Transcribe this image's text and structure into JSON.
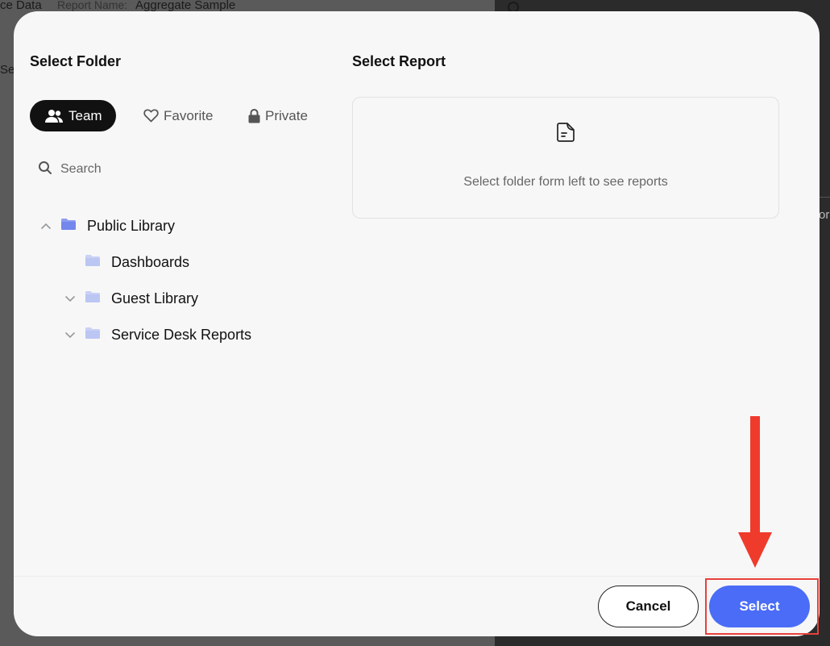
{
  "backdrop": {
    "data_label": "ce Data",
    "report_name_label": "Report Name:",
    "report_name_value": "Aggregate Sample",
    "side_text": "Se",
    "right_text": "or"
  },
  "modal": {
    "folder_title": "Select Folder",
    "report_title": "Select Report",
    "tabs": [
      {
        "label": "Team",
        "icon": "users-icon",
        "active": true
      },
      {
        "label": "Favorite",
        "icon": "heart-icon",
        "active": false
      },
      {
        "label": "Private",
        "icon": "lock-icon",
        "active": false
      }
    ],
    "search": {
      "placeholder": "Search"
    },
    "tree": [
      {
        "label": "Public Library",
        "expanded": true,
        "level": 0
      },
      {
        "label": "Dashboards",
        "expanded": false,
        "level": 1
      },
      {
        "label": "Guest Library",
        "expanded": false,
        "level": 1
      },
      {
        "label": "Service Desk Reports",
        "expanded": false,
        "level": 1
      }
    ],
    "report_empty_text": "Select folder form left to see reports",
    "buttons": {
      "cancel": "Cancel",
      "select": "Select"
    }
  },
  "colors": {
    "accent": "#4a6cf7",
    "folder_primary": "#8c9cf0",
    "folder_light": "#c9d1f5",
    "annotation": "#ef3b2c"
  }
}
